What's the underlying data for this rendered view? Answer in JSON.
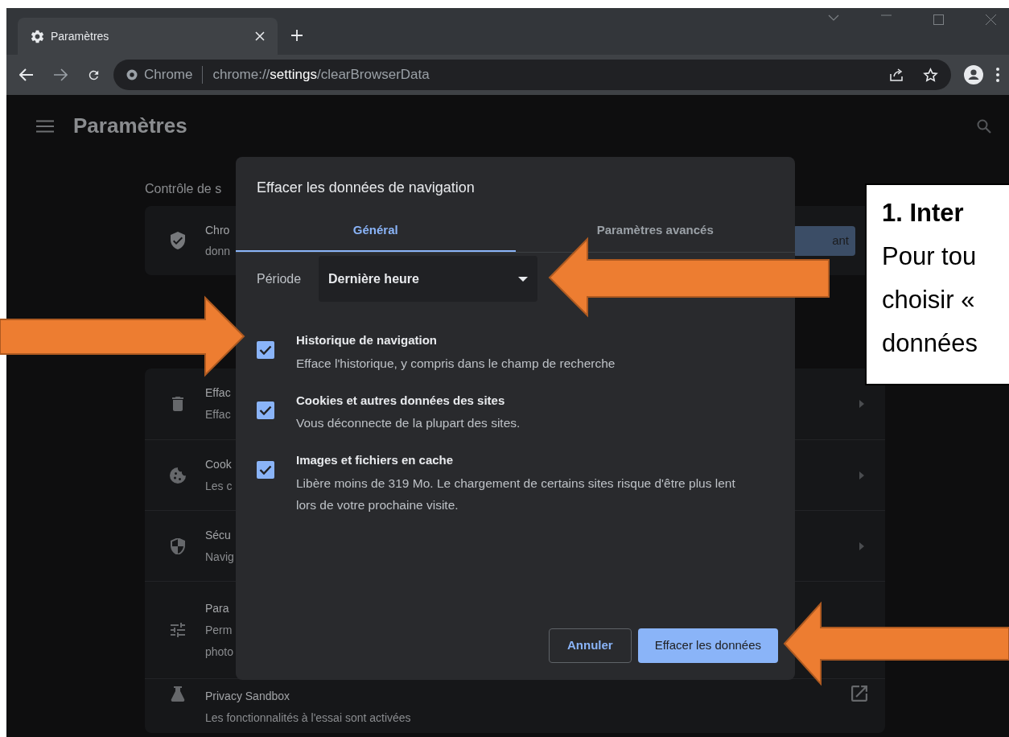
{
  "browser": {
    "tab": {
      "title": "Paramètres"
    },
    "address": {
      "site_label": "Chrome",
      "url": "chrome://**settings**/clearBrowserData"
    }
  },
  "page": {
    "title": "Paramètres",
    "section_title": "Contrôle de s",
    "safety_card": {
      "title": "Chro",
      "subtitle": "donn",
      "button": "ant"
    },
    "rows": [
      {
        "kind": "submenu",
        "title": "Effac",
        "lines": [
          "Effac"
        ]
      },
      {
        "kind": "submenu",
        "title": "Cook",
        "lines": [
          "Les c"
        ]
      },
      {
        "kind": "submenu",
        "title": "Sécu",
        "lines": [
          "Navig"
        ]
      },
      {
        "kind": "plain",
        "title": "Para",
        "lines": [
          "Perm",
          "photo"
        ]
      },
      {
        "kind": "external",
        "title": "Privacy Sandbox",
        "lines": [
          "Les fonctionnalités à l'essai sont activées"
        ]
      }
    ]
  },
  "dialog": {
    "title": "Effacer les données de navigation",
    "tabs": [
      {
        "label": "Général",
        "selected": true
      },
      {
        "label": "Paramètres avancés",
        "selected": false
      }
    ],
    "period": {
      "label": "Période",
      "value": "Dernière heure"
    },
    "options": [
      {
        "title": "Historique de navigation",
        "description": "Efface l'historique, y compris dans le champ de recherche",
        "checked": true
      },
      {
        "title": "Cookies et autres données des sites",
        "description": "Vous déconnecte de la plupart des sites.",
        "checked": true
      },
      {
        "title": "Images et fichiers en cache",
        "description": "Libère moins de 319 Mo. Le chargement de certains sites risque d'être plus lent lors de votre prochaine visite.",
        "checked": true
      }
    ],
    "buttons": [
      {
        "label": "Annuler",
        "kind": "secondary"
      },
      {
        "label": "Effacer les données",
        "kind": "primary"
      }
    ]
  },
  "callout": {
    "heading": "1. Inter",
    "lines": [
      "Pour tou",
      "choisir «",
      "données"
    ]
  }
}
